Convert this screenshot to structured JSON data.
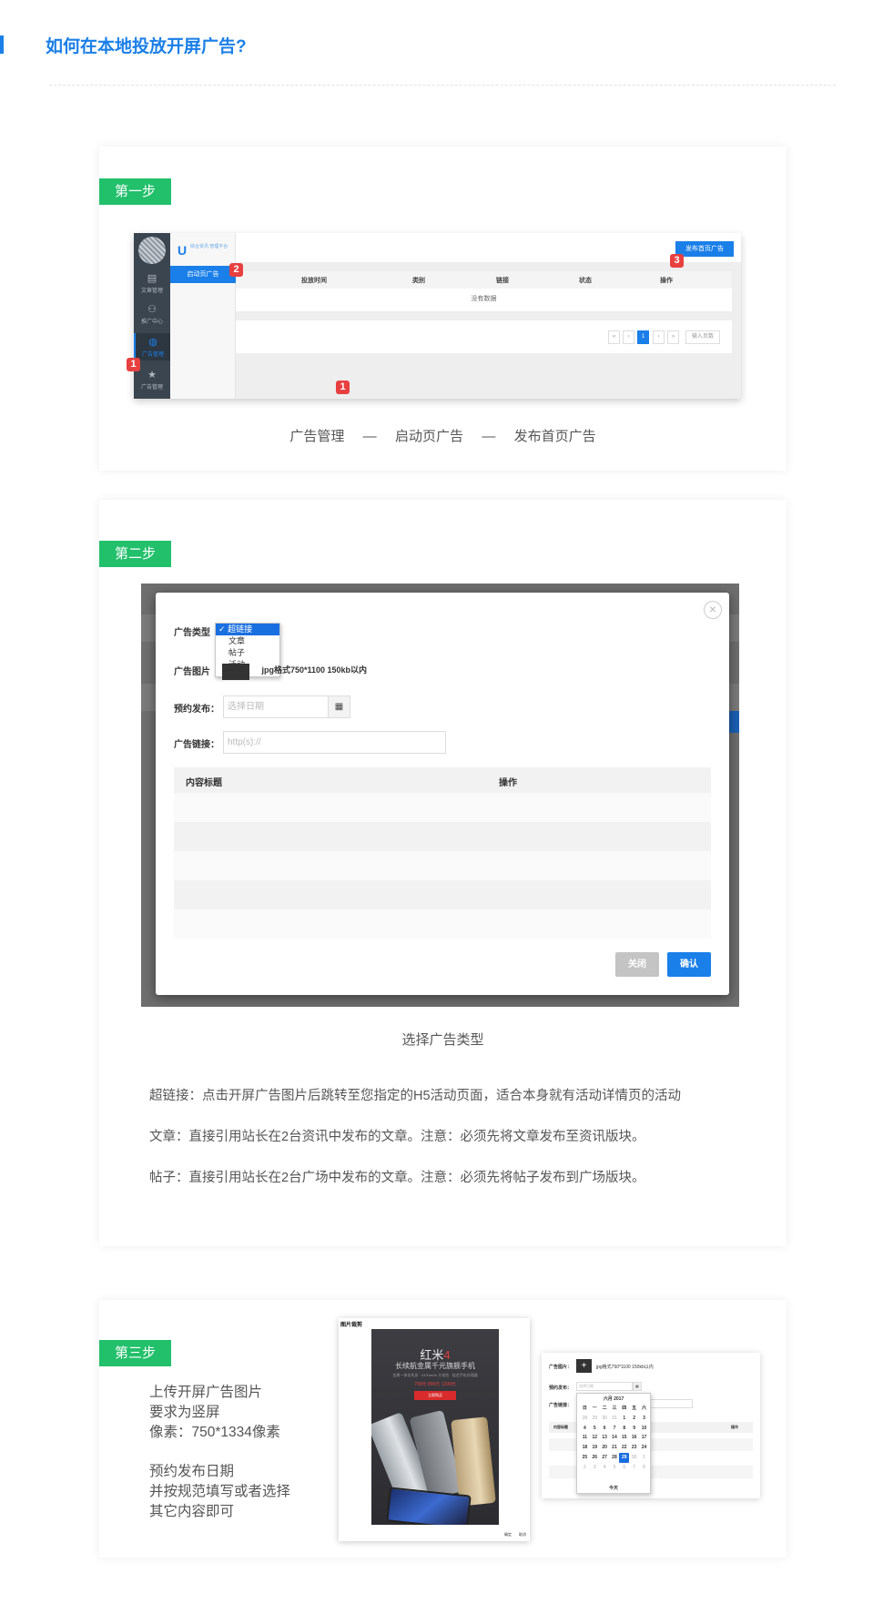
{
  "page": {
    "title": "如何在本地投放开屏广告?"
  },
  "step1": {
    "label": "第一步",
    "logo_letter": "U",
    "logo_text": "综合资讯 管理平台",
    "sidebar": [
      {
        "icon": "document-icon",
        "glyph": "▤",
        "label": "文章管理"
      },
      {
        "icon": "users-icon",
        "glyph": "⚇",
        "label": "推广中心"
      },
      {
        "icon": "globe-icon",
        "glyph": "◍",
        "label": "广告管理"
      },
      {
        "icon": "star-icon",
        "glyph": "★",
        "label": "广告管理"
      }
    ],
    "submenu_active": "启动页广告",
    "publish_button": "发布首页广告",
    "table_headers": [
      "投放时间",
      "类别",
      "链接",
      "状态",
      "操作"
    ],
    "empty_text": "没有数据",
    "pager": {
      "first": "«",
      "prev": "‹",
      "current": "1",
      "next": "›",
      "last": "»",
      "jump_placeholder": "输入页数"
    },
    "badges": [
      "1",
      "2",
      "3"
    ],
    "caption": "广告管理  —  启动页广告  —  发布首页广告"
  },
  "step2": {
    "label": "第二步",
    "modal": {
      "close_glyph": "×",
      "type_label": "广告类型",
      "type_options": [
        "超链接",
        "文章",
        "帖子",
        "活动"
      ],
      "type_selected_prefix": "✓",
      "image_label": "广告图片",
      "image_hint": "jpg格式750*1100 150kb以内",
      "schedule_label": "预约发布：",
      "schedule_placeholder": "选择日期",
      "calendar_glyph": "▦",
      "link_label": "广告链接：",
      "link_placeholder": "http(s)://",
      "table_headers": [
        "内容标题",
        "操作"
      ],
      "cancel_button": "关闭",
      "confirm_button": "确认"
    },
    "caption": "选择广告类型",
    "descriptions": [
      "超链接：点击开屏广告图片后跳转至您指定的H5活动页面，适合本身就有活动详情页的活动",
      "文章：直接引用站长在2台资讯中发布的文章。注意：必须先将文章发布至资讯版块。",
      "帖子：直接引用站长在2台广场中发布的文章。注意：必须先将帖子发布到广场版块。"
    ]
  },
  "step3": {
    "label": "第三步",
    "lines_group1": [
      "上传开屏广告图片",
      "要求为竖屏",
      "像素：750*1334像素"
    ],
    "lines_group2": [
      "预约发布日期",
      "并按规范填写或者选择",
      "其它内容即可"
    ],
    "crop_title": "图片裁剪",
    "ad": {
      "brand": "红米",
      "brand_num": "4",
      "headline": "长续航金属千元旗舰手机",
      "fine_print": "金属一体化机身 · 4100mAh 大电池 · 骁龙手机处理器",
      "price": "799元   899元   1299元",
      "buy": "立即购买"
    },
    "crop_buttons": [
      "确定",
      "取消"
    ],
    "form": {
      "image_label": "广告图片：",
      "plus": "+",
      "image_hint": "jpg格式750*1100 150kb以内",
      "schedule_label": "预约发布：",
      "schedule_placeholder": "选择日期",
      "link_label": "广告链接：",
      "table_header": "内容标题",
      "table_action": "操作"
    },
    "calendar": {
      "title": "六月 2017",
      "weekdays": [
        "日",
        "一",
        "二",
        "三",
        "四",
        "五",
        "六"
      ],
      "days": [
        "28",
        "29",
        "30",
        "31",
        "1",
        "2",
        "3",
        "4",
        "5",
        "6",
        "7",
        "8",
        "9",
        "10",
        "11",
        "12",
        "13",
        "14",
        "15",
        "16",
        "17",
        "18",
        "19",
        "20",
        "21",
        "22",
        "23",
        "24",
        "25",
        "26",
        "27",
        "28",
        "29",
        "30",
        "1",
        "2",
        "3",
        "4",
        "5",
        "6",
        "7",
        "8"
      ],
      "selected": "29",
      "today": "今天"
    }
  },
  "colors": {
    "accent": "#1a7fe8",
    "step_green": "#22c06b",
    "badge_red": "#e84040"
  }
}
